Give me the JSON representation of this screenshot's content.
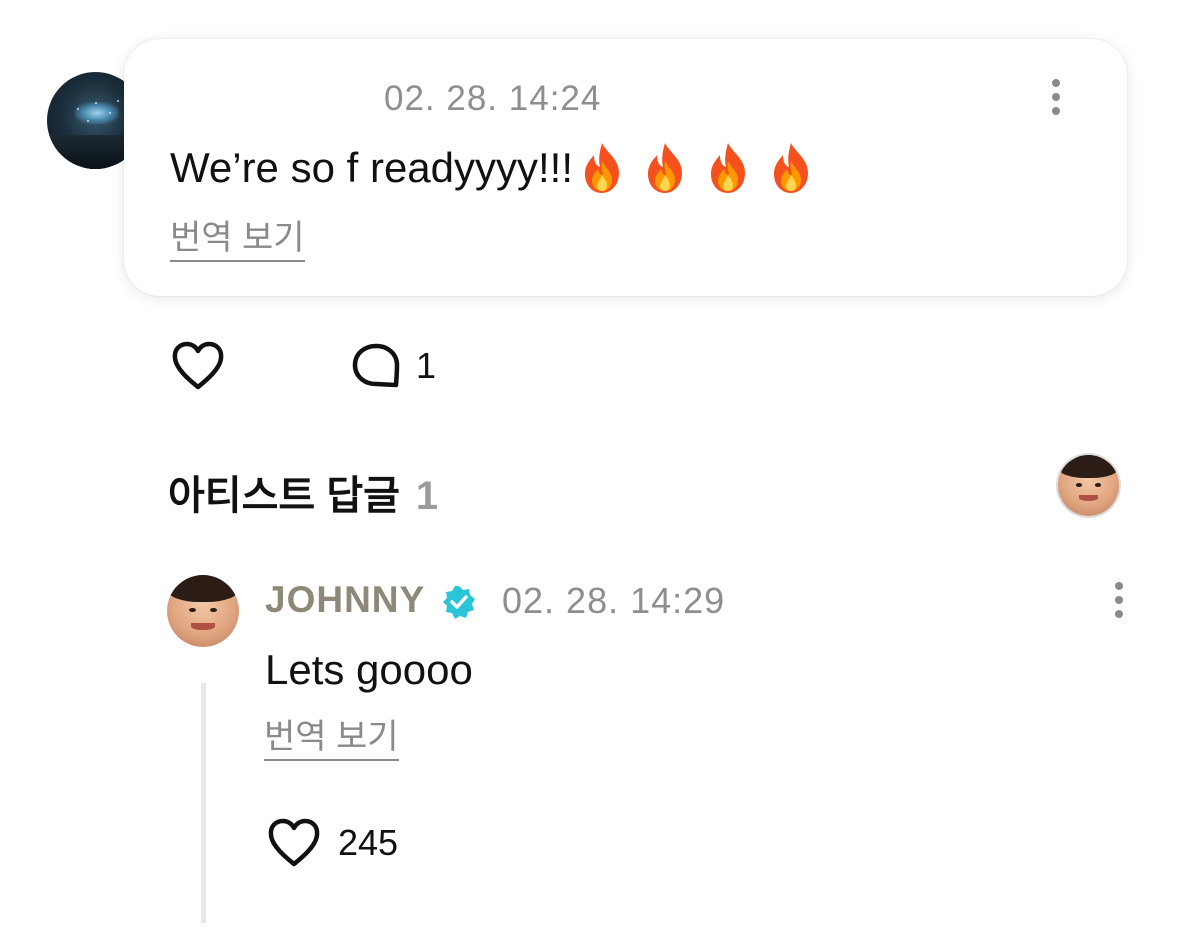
{
  "post": {
    "timestamp": "02. 28. 14:24",
    "text": "We’re so f readyyyy!!!",
    "emojis": [
      "fire",
      "fire",
      "fire",
      "fire"
    ],
    "translate_label": "번역 보기",
    "avatar": "concert-stage-avatar",
    "more_icon": "more-vertical-icon"
  },
  "actions": {
    "like_icon": "heart-outline-icon",
    "comment_icon": "comment-bubble-icon",
    "comment_count": "1"
  },
  "artist_replies": {
    "title": "아티스트 답글",
    "count": "1"
  },
  "reply": {
    "author": "JOHNNY",
    "verified_icon": "verified-badge-icon",
    "timestamp": "02. 28. 14:29",
    "text": "Lets goooo",
    "translate_label": "번역 보기",
    "like_count": "245"
  },
  "colors": {
    "verified": "#2bc4d8",
    "author_name": "#8d8877",
    "muted_text": "#8e8e8e",
    "thread_line": "#e7e7ec"
  }
}
